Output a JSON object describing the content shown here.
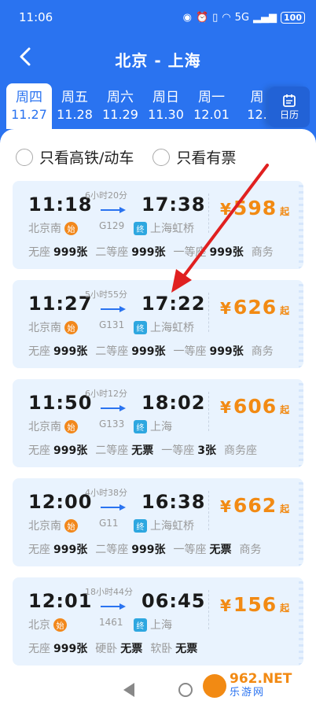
{
  "status_bar": {
    "time": "11:06",
    "battery": "100",
    "network": "5G"
  },
  "header": {
    "title": "北京 - 上海"
  },
  "dates": [
    {
      "weekday": "周四",
      "date": "11.27",
      "active": true
    },
    {
      "weekday": "周五",
      "date": "11.28"
    },
    {
      "weekday": "周六",
      "date": "11.29"
    },
    {
      "weekday": "周日",
      "date": "11.30"
    },
    {
      "weekday": "周一",
      "date": "12.01"
    },
    {
      "weekday": "周",
      "date": "12."
    }
  ],
  "calendar_label": "日历",
  "filters": {
    "high_speed": "只看高铁/动车",
    "available": "只看有票"
  },
  "trains": [
    {
      "dep_time": "11:18",
      "arr_time": "17:38",
      "duration": "6小时20分",
      "train_no": "G129",
      "dep_station": "北京南",
      "dep_badge": "始",
      "arr_station": "上海虹桥",
      "arr_badge": "终",
      "currency": "¥",
      "price": "598",
      "price_suffix": "起",
      "seats": [
        {
          "type": "无座",
          "count": "999张"
        },
        {
          "type": "二等座",
          "count": "999张"
        },
        {
          "type": "一等座",
          "count": "999张"
        },
        {
          "type": "商务",
          "count": ""
        }
      ]
    },
    {
      "dep_time": "11:27",
      "arr_time": "17:22",
      "duration": "5小时55分",
      "train_no": "G131",
      "dep_station": "北京南",
      "dep_badge": "始",
      "arr_station": "上海虹桥",
      "arr_badge": "终",
      "currency": "¥",
      "price": "626",
      "price_suffix": "起",
      "seats": [
        {
          "type": "无座",
          "count": "999张"
        },
        {
          "type": "二等座",
          "count": "999张"
        },
        {
          "type": "一等座",
          "count": "999张"
        },
        {
          "type": "商务",
          "count": ""
        }
      ]
    },
    {
      "dep_time": "11:50",
      "arr_time": "18:02",
      "duration": "6小时12分",
      "train_no": "G133",
      "dep_station": "北京南",
      "dep_badge": "始",
      "arr_station": "上海",
      "arr_badge": "终",
      "currency": "¥",
      "price": "606",
      "price_suffix": "起",
      "seats": [
        {
          "type": "无座",
          "count": "999张"
        },
        {
          "type": "二等座",
          "count": "无票"
        },
        {
          "type": "一等座",
          "count": "3张"
        },
        {
          "type": "商务座",
          "count": ""
        }
      ]
    },
    {
      "dep_time": "12:00",
      "arr_time": "16:38",
      "duration": "4小时38分",
      "train_no": "G11",
      "dep_station": "北京南",
      "dep_badge": "始",
      "arr_station": "上海虹桥",
      "arr_badge": "终",
      "currency": "¥",
      "price": "662",
      "price_suffix": "起",
      "seats": [
        {
          "type": "无座",
          "count": "999张"
        },
        {
          "type": "二等座",
          "count": "999张"
        },
        {
          "type": "一等座",
          "count": "无票"
        },
        {
          "type": "商务",
          "count": ""
        }
      ]
    },
    {
      "dep_time": "12:01",
      "arr_time": "06:45",
      "duration": "18小时44分",
      "train_no": "1461",
      "dep_station": "北京",
      "dep_badge": "始",
      "arr_station": "上海",
      "arr_badge": "终",
      "currency": "¥",
      "price": "156",
      "price_suffix": "起",
      "seats": [
        {
          "type": "无座",
          "count": "999张"
        },
        {
          "type": "硬卧",
          "count": "无票"
        },
        {
          "type": "软卧",
          "count": "无票"
        }
      ]
    }
  ],
  "watermark": {
    "text_top": "962.NET",
    "text_bottom": "乐游网"
  },
  "colors": {
    "primary": "#2a73f0",
    "price": "#f28a13",
    "card_bg": "#e9f3fe",
    "arrow_annotation": "#e02020"
  }
}
